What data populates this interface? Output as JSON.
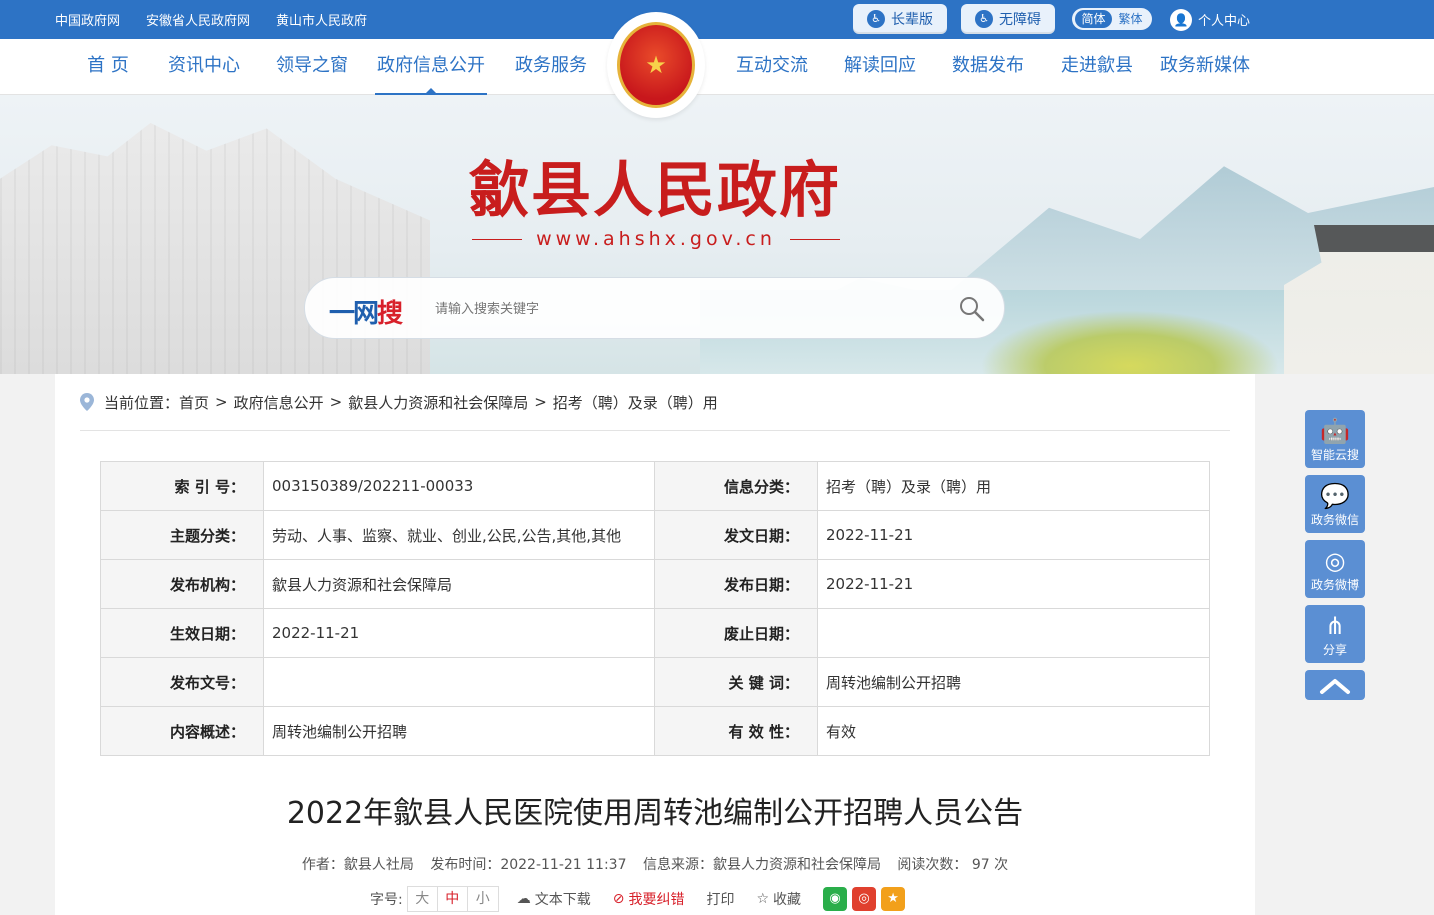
{
  "top": {
    "links": [
      "中国政府网",
      "安徽省人民政府网",
      "黄山市人民政府"
    ],
    "elder_label": "长辈版",
    "access_label": "无障碍",
    "lang": [
      "简体",
      "繁体"
    ],
    "user_center": "个人中心"
  },
  "nav": {
    "items": [
      "首 页",
      "资讯中心",
      "领导之窗",
      "政府信息公开",
      "政务服务",
      "互动交流",
      "解读回应",
      "数据发布",
      "走进歙县",
      "政务新媒体"
    ],
    "active": "政府信息公开"
  },
  "banner": {
    "title": "歙县人民政府",
    "url": "www.ahshx.gov.cn",
    "search_brand_a": "一网",
    "search_brand_b": "搜",
    "search_placeholder": "请输入搜索关键字"
  },
  "breadcrumb": {
    "label": "当前位置：",
    "items": [
      "首页",
      "政府信息公开",
      "歙县人力资源和社会保障局",
      "招考（聘）及录（聘）用"
    ]
  },
  "meta": {
    "rows": [
      {
        "k1": "索 引 号：",
        "v1": "003150389/202211-00033",
        "k2": "信息分类：",
        "v2": "招考（聘）及录（聘）用"
      },
      {
        "k1": "主题分类：",
        "v1": "劳动、人事、监察、就业、创业,公民,公告,其他,其他",
        "k2": "发文日期：",
        "v2": "2022-11-21"
      },
      {
        "k1": "发布机构：",
        "v1": "歙县人力资源和社会保障局",
        "k2": "发布日期：",
        "v2": "2022-11-21"
      },
      {
        "k1": "生效日期：",
        "v1": "2022-11-21",
        "k2": "废止日期：",
        "v2": ""
      },
      {
        "k1": "发布文号：",
        "v1": "",
        "k2": "关 键 词：",
        "v2": "周转池编制公开招聘"
      },
      {
        "k1": "内容概述：",
        "v1": "周转池编制公开招聘",
        "k2": "有 效 性：",
        "v2": "有效"
      }
    ]
  },
  "article": {
    "title": "2022年歙县人民医院使用周转池编制公开招聘人员公告",
    "author": "作者：歙县人社局",
    "time": "发布时间：2022-11-21 11:37",
    "source": "信息来源：歙县人力资源和社会保障局",
    "reads": "阅读次数： 97 次",
    "font_label": "字号:",
    "font_sizes": [
      "大",
      "中",
      "小"
    ],
    "download": "文本下载",
    "correct": "我要纠错",
    "print": "打印",
    "favorite": "收藏"
  },
  "side": {
    "items": [
      "智能云搜",
      "政务微信",
      "政务微博",
      "分享"
    ]
  },
  "icons": {
    "elder": "elderly-icon",
    "access": "wheelchair-icon",
    "user": "user-icon",
    "search": "search-icon",
    "pin": "location-pin-icon",
    "wechat": "wechat-icon",
    "weibo": "weibo-icon",
    "qzone": "star-icon"
  },
  "colors": {
    "primary": "#2d73c5",
    "title_red": "#c81d1d",
    "accent_red": "#d8202a"
  }
}
